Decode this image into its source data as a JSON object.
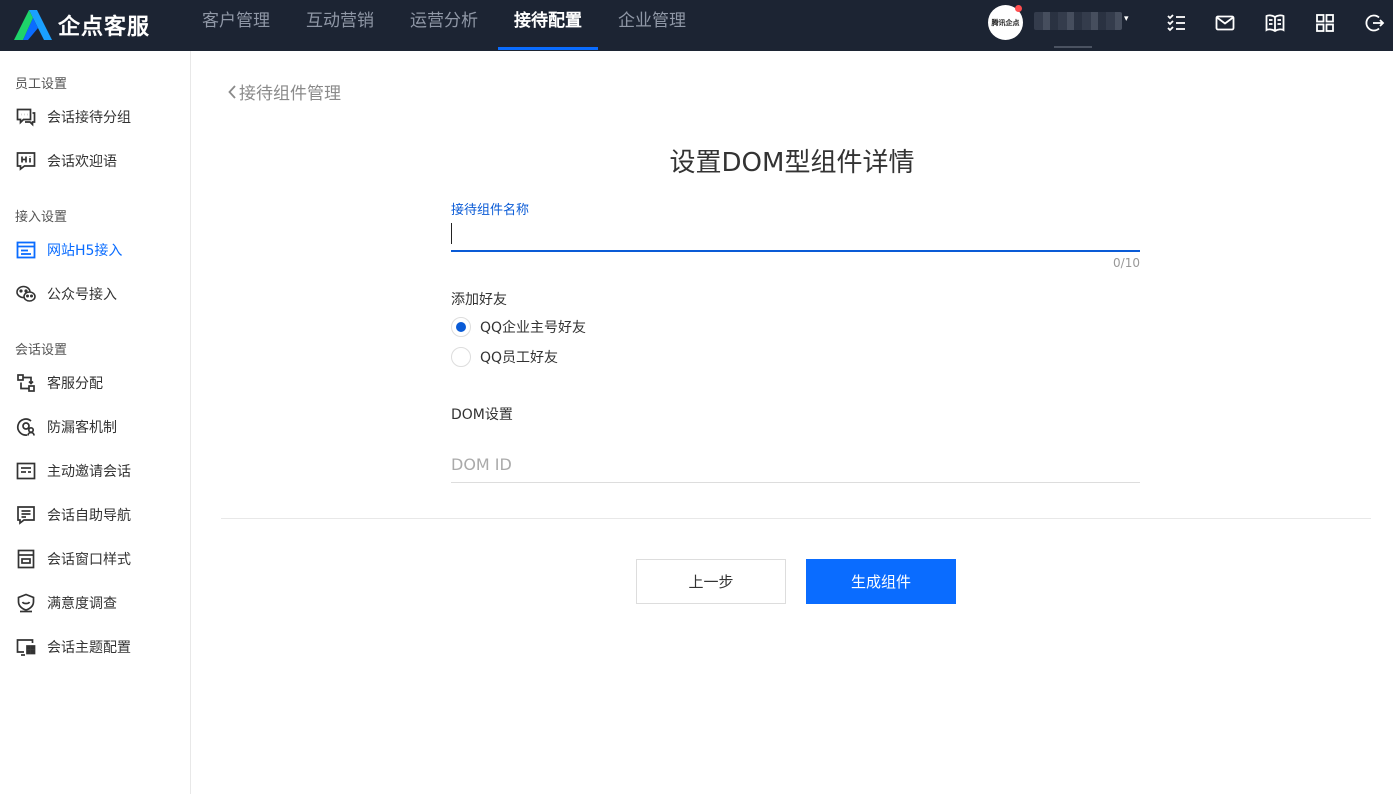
{
  "app": {
    "name": "企点客服",
    "avatar_text": "腾讯企点"
  },
  "nav": [
    {
      "label": "客户管理",
      "active": false
    },
    {
      "label": "互动营销",
      "active": false
    },
    {
      "label": "运营分析",
      "active": false
    },
    {
      "label": "接待配置",
      "active": true
    },
    {
      "label": "企业管理",
      "active": false
    }
  ],
  "sidebar": {
    "groups": [
      {
        "title": "员工设置",
        "items": [
          {
            "label": "会话接待分组",
            "icon": "chat-group-icon"
          },
          {
            "label": "会话欢迎语",
            "icon": "hi-greeting-icon"
          }
        ]
      },
      {
        "title": "接入设置",
        "items": [
          {
            "label": "网站H5接入",
            "icon": "website-icon",
            "active": true
          },
          {
            "label": "公众号接入",
            "icon": "wechat-icon"
          }
        ]
      },
      {
        "title": "会话设置",
        "items": [
          {
            "label": "客服分配",
            "icon": "distribute-icon"
          },
          {
            "label": "防漏客机制",
            "icon": "anti-leak-icon"
          },
          {
            "label": "主动邀请会话",
            "icon": "invite-icon"
          },
          {
            "label": "会话自助导航",
            "icon": "navigation-icon"
          },
          {
            "label": "会话窗口样式",
            "icon": "window-style-icon"
          },
          {
            "label": "满意度调查",
            "icon": "satisfaction-icon"
          },
          {
            "label": "会话主题配置",
            "icon": "theme-icon"
          }
        ]
      }
    ]
  },
  "main": {
    "back_label": "接待组件管理",
    "title": "设置DOM型组件详情",
    "name_field": {
      "label": "接待组件名称",
      "value": "",
      "counter": "0/10"
    },
    "add_friend": {
      "label": "添加好友",
      "options": [
        {
          "label": "QQ企业主号好友",
          "checked": true
        },
        {
          "label": "QQ员工好友",
          "checked": false
        }
      ]
    },
    "dom_settings": {
      "label": "DOM设置",
      "placeholder": "DOM ID"
    },
    "buttons": {
      "prev": "上一步",
      "generate": "生成组件"
    }
  },
  "colors": {
    "topbar": "#1c2433",
    "accent": "#0a6cff",
    "link": "#0a5bd6"
  }
}
